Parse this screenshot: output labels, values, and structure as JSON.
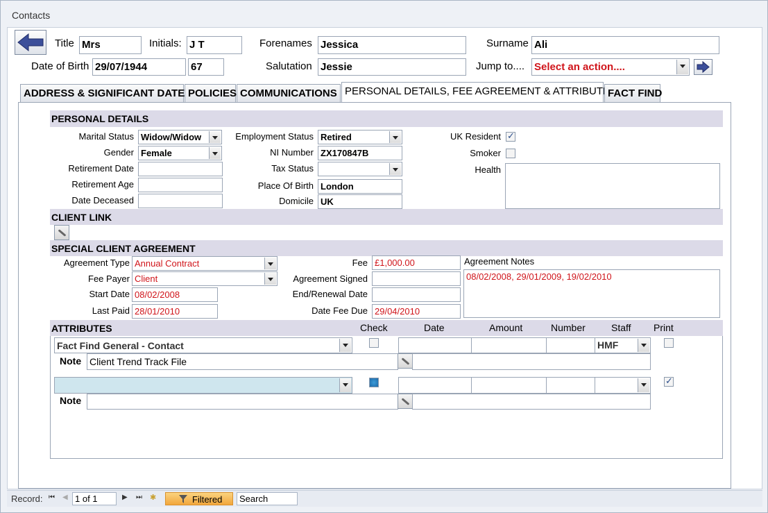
{
  "window": {
    "title": "Contacts"
  },
  "header": {
    "title_label": "Title",
    "title_value": "Mrs",
    "initials_label": "Initials:",
    "initials_value": "J T",
    "forenames_label": "Forenames",
    "forenames_value": "Jessica",
    "surname_label": "Surname",
    "surname_value": "Ali",
    "dob_label": "Date of Birth",
    "dob_value": "29/07/1944",
    "age_value": "67",
    "salutation_label": "Salutation",
    "salutation_value": "Jessie",
    "jump_label": "Jump to....",
    "jump_value": "Select an action...."
  },
  "tabs": [
    {
      "label": "ADDRESS & SIGNIFICANT DATES"
    },
    {
      "label": "POLICIES"
    },
    {
      "label": "COMMUNICATIONS"
    },
    {
      "label": "PERSONAL DETAILS, FEE AGREEMENT & ATTRIBUTES"
    },
    {
      "label": "FACT FIND"
    }
  ],
  "personal": {
    "heading": "PERSONAL DETAILS",
    "marital_label": "Marital Status",
    "marital_value": "Widow/Widow",
    "gender_label": "Gender",
    "gender_value": "Female",
    "retirement_date_label": "Retirement Date",
    "retirement_date_value": "",
    "retirement_age_label": "Retirement Age",
    "retirement_age_value": "",
    "date_deceased_label": "Date Deceased",
    "date_deceased_value": "",
    "employment_label": "Employment Status",
    "employment_value": "Retired",
    "ni_label": "NI Number",
    "ni_value": "ZX170847B",
    "tax_label": "Tax Status",
    "tax_value": "",
    "pob_label": "Place Of Birth",
    "pob_value": "London",
    "domicile_label": "Domicile",
    "domicile_value": "UK",
    "uk_resident_label": "UK Resident",
    "uk_resident": true,
    "smoker_label": "Smoker",
    "smoker": false,
    "health_label": "Health",
    "health_value": ""
  },
  "client_link": {
    "heading": "CLIENT LINK"
  },
  "agreement": {
    "heading": "SPECIAL CLIENT AGREEMENT",
    "type_label": "Agreement Type",
    "type_value": "Annual Contract",
    "payer_label": "Fee Payer",
    "payer_value": "Client",
    "start_label": "Start Date",
    "start_value": "08/02/2008",
    "last_paid_label": "Last Paid",
    "last_paid_value": "28/01/2010",
    "fee_label": "Fee",
    "fee_value": "£1,000.00",
    "signed_label": "Agreement Signed",
    "signed_value": "",
    "end_label": "End/Renewal Date",
    "end_value": "",
    "due_label": "Date Fee Due",
    "due_value": "29/04/2010",
    "notes_label": "Agreement Notes",
    "notes_value": "08/02/2008, 29/01/2009, 19/02/2010"
  },
  "attributes": {
    "heading": "ATTRIBUTES",
    "columns": {
      "check": "Check",
      "date": "Date",
      "amount": "Amount",
      "number": "Number",
      "staff": "Staff",
      "print": "Print"
    },
    "rows": [
      {
        "attribute": "Fact Find General - Contact",
        "note_label": "Note",
        "note": "Client Trend Track File",
        "staff": "HMF",
        "check": false,
        "print": false
      },
      {
        "attribute": "",
        "note_label": "Note",
        "note": "",
        "staff": "",
        "check": true,
        "print": true
      }
    ]
  },
  "nav": {
    "record_label": "Record:",
    "position": "1 of 1",
    "filter_label": "Filtered",
    "search_label": "Search"
  },
  "colors": {
    "accent_red": "#d0141a",
    "section_bg": "#dcdae8",
    "filter_bg": "#f5b24c"
  }
}
